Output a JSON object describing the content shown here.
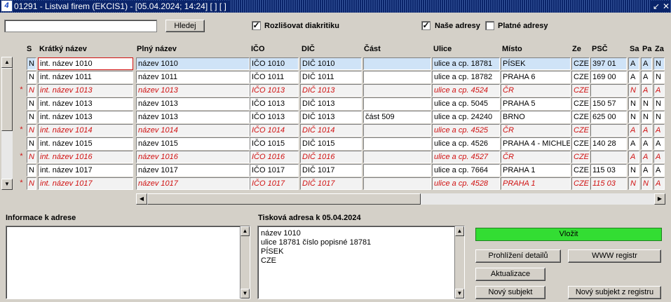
{
  "window": {
    "title": "01291 - Listval firem (EKCIS1) - [05.04.2024; 14:24]  [ ]  [ ]",
    "icon": "app-icon",
    "controls": [
      "↙",
      "✕"
    ]
  },
  "toolbar": {
    "search_value": "",
    "search_button": "Hledej",
    "diacritics_label": "Rozlišovat diakritiku",
    "diacritics_checked": true,
    "our_addresses_label": "Naše adresy",
    "our_addresses_checked": true,
    "valid_addresses_label": "Platné adresy",
    "valid_addresses_checked": false
  },
  "grid": {
    "columns": [
      "S",
      "Krátký název",
      "Plný název",
      "IČO",
      "DIČ",
      "Část",
      "Ulice",
      "Místo",
      "Ze",
      "PSČ",
      "Sa",
      "Pa",
      "Za"
    ],
    "rows": [
      {
        "mark": "",
        "s": "N",
        "short": "int. název 1010",
        "full": "název 1010",
        "ico": "IČO 1010",
        "dic": "DIČ 1010",
        "part": "",
        "street": "ulice a cp. 18781",
        "city": "PÍSEK",
        "ze": "CZE",
        "psc": "397 01",
        "sa": "A",
        "pa": "A",
        "za": "N",
        "selected": true,
        "inactive": false
      },
      {
        "mark": "",
        "s": "N",
        "short": "int. název 1011",
        "full": "název 1011",
        "ico": "IČO 1011",
        "dic": "DIČ 1011",
        "part": "",
        "street": "ulice a cp. 18782",
        "city": "PRAHA 6",
        "ze": "CZE",
        "psc": "169 00",
        "sa": "A",
        "pa": "A",
        "za": "N",
        "selected": false,
        "inactive": false
      },
      {
        "mark": "*",
        "s": "N",
        "short": "int. název 1013",
        "full": "název 1013",
        "ico": "IČO 1013",
        "dic": "DIČ 1013",
        "part": "",
        "street": "ulice a cp. 4524",
        "city": "ČR",
        "ze": "CZE",
        "psc": "",
        "sa": "N",
        "pa": "A",
        "za": "A",
        "selected": false,
        "inactive": true
      },
      {
        "mark": "",
        "s": "N",
        "short": "int. název 1013",
        "full": "název 1013",
        "ico": "IČO 1013",
        "dic": "DIČ 1013",
        "part": "",
        "street": "ulice a cp. 5045",
        "city": "PRAHA 5",
        "ze": "CZE",
        "psc": "150 57",
        "sa": "N",
        "pa": "N",
        "za": "N",
        "selected": false,
        "inactive": false
      },
      {
        "mark": "",
        "s": "N",
        "short": "int. název 1013",
        "full": "název 1013",
        "ico": "IČO 1013",
        "dic": "DIČ 1013",
        "part": "část 509",
        "street": "ulice a cp. 24240",
        "city": "BRNO",
        "ze": "CZE",
        "psc": "625 00",
        "sa": "N",
        "pa": "N",
        "za": "N",
        "selected": false,
        "inactive": false
      },
      {
        "mark": "*",
        "s": "N",
        "short": "int. název 1014",
        "full": "název 1014",
        "ico": "IČO 1014",
        "dic": "DIČ 1014",
        "part": "",
        "street": "ulice a cp. 4525",
        "city": "ČR",
        "ze": "CZE",
        "psc": "",
        "sa": "A",
        "pa": "A",
        "za": "A",
        "selected": false,
        "inactive": true
      },
      {
        "mark": "",
        "s": "N",
        "short": "int. název 1015",
        "full": "název 1015",
        "ico": "IČO 1015",
        "dic": "DIČ 1015",
        "part": "",
        "street": "ulice a cp. 4526",
        "city": "PRAHA 4 - MICHLE",
        "ze": "CZE",
        "psc": "140 28",
        "sa": "A",
        "pa": "A",
        "za": "A",
        "selected": false,
        "inactive": false
      },
      {
        "mark": "*",
        "s": "N",
        "short": "int. název 1016",
        "full": "název 1016",
        "ico": "IČO 1016",
        "dic": "DIČ 1016",
        "part": "",
        "street": "ulice a cp. 4527",
        "city": "ČR",
        "ze": "CZE",
        "psc": "",
        "sa": "A",
        "pa": "A",
        "za": "A",
        "selected": false,
        "inactive": true
      },
      {
        "mark": "",
        "s": "N",
        "short": "int. název 1017",
        "full": "název 1017",
        "ico": "IČO 1017",
        "dic": "DIČ 1017",
        "part": "",
        "street": "ulice a cp. 7664",
        "city": "PRAHA 1",
        "ze": "CZE",
        "psc": "115 03",
        "sa": "N",
        "pa": "A",
        "za": "A",
        "selected": false,
        "inactive": false
      },
      {
        "mark": "*",
        "s": "N",
        "short": "int. název 1017",
        "full": "název 1017",
        "ico": "IČO 1017",
        "dic": "DIČ 1017",
        "part": "",
        "street": "ulice a cp. 4528",
        "city": "PRAHA  1",
        "ze": "CZE",
        "psc": "115 03",
        "sa": "N",
        "pa": "N",
        "za": "A",
        "selected": false,
        "inactive": true
      }
    ]
  },
  "info": {
    "label": "Informace k adrese",
    "text": ""
  },
  "print_address": {
    "label": "Tisková adresa k 05.04.2024",
    "lines": [
      "název 1010",
      "ulice 18781 číslo popisné 18781",
      "PÍSEK",
      "CZE"
    ]
  },
  "actions": {
    "insert": "Vložit",
    "details": "Prohlížení detailů",
    "www_registry": "WWW registr",
    "update": "Aktualizace",
    "new_subject": "Nový subjekt",
    "new_subject_registry": "Nový subjekt z registru"
  },
  "colors": {
    "selected_row": "#cfe3f7",
    "inactive_text": "#d01010",
    "insert_button": "#33dd33",
    "title_bar": "#0a246a"
  }
}
